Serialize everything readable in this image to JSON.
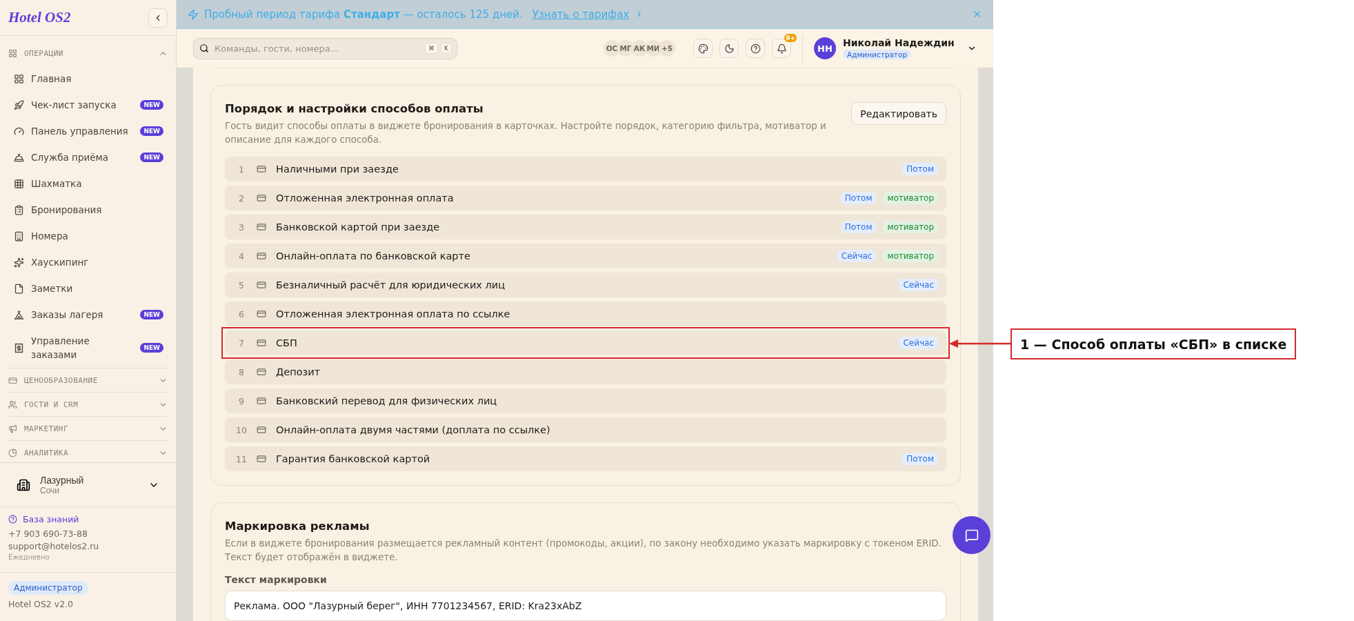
{
  "sidebar": {
    "logo": "Hotel OS2",
    "groups": [
      {
        "label": "ОПЕРАЦИИ",
        "expanded": true,
        "items": [
          {
            "label": "Главная"
          },
          {
            "label": "Чек-лист запуска",
            "badge": "NEW"
          },
          {
            "label": "Панель управления",
            "badge": "NEW"
          },
          {
            "label": "Служба приёма",
            "badge": "NEW"
          },
          {
            "label": "Шахматка"
          },
          {
            "label": "Бронирования"
          },
          {
            "label": "Номера"
          },
          {
            "label": "Хаускипинг"
          },
          {
            "label": "Заметки"
          },
          {
            "label": "Заказы лагеря",
            "badge": "NEW"
          },
          {
            "label": "Управление заказами",
            "badge": "NEW"
          }
        ]
      },
      {
        "label": "ЦЕНООБРАЗОВАНИЕ",
        "expanded": false
      },
      {
        "label": "ГОСТИ И CRM",
        "expanded": false
      },
      {
        "label": "МАРКЕТИНГ",
        "expanded": false
      },
      {
        "label": "АНАЛИТИКА",
        "expanded": false
      }
    ],
    "hotel": {
      "name": "Лазурный",
      "city": "Сочи"
    },
    "support": {
      "link": "База знаний",
      "phone": "+7 903 690-73-88",
      "email": "support@hotelos2.ru",
      "hours": "Ежедневно"
    },
    "role": "Администратор",
    "version": "Hotel OS2 v2.0"
  },
  "banner": {
    "text": "Пробный период тарифа **Стандарт** — осталось 125 дней.",
    "link": "Узнать о тарифах"
  },
  "header": {
    "search_placeholder": "Команды, гости, номера...",
    "shortcut": [
      "⌘",
      "K"
    ],
    "online_users": [
      "ОС",
      "МГ",
      "АК",
      "МИ",
      "+5"
    ],
    "notifications_badge": "9+",
    "user": {
      "initials": "НН",
      "name": "Николай Надеждин",
      "role": "Администратор"
    }
  },
  "payment_methods": {
    "title": "Порядок и настройки способов оплаты",
    "description": "Гость видит способы оплаты в виджете бронирования в карточках. Настройте порядок, категорию фильтра, мотиватор и описание для каждого способа.",
    "edit_button": "Редактировать",
    "rows": [
      {
        "number": "1",
        "name": "Наличными при заезде",
        "highlighted": false,
        "tags": [
          {
            "kind": "timing",
            "text": "Потом"
          }
        ]
      },
      {
        "number": "2",
        "name": "Отложенная электронная оплата",
        "highlighted": false,
        "tags": [
          {
            "kind": "timing",
            "text": "Потом"
          },
          {
            "kind": "motivator",
            "text": "мотиватор"
          }
        ]
      },
      {
        "number": "3",
        "name": "Банковской картой при заезде",
        "highlighted": false,
        "tags": [
          {
            "kind": "timing",
            "text": "Потом"
          },
          {
            "kind": "motivator",
            "text": "мотиватор"
          }
        ]
      },
      {
        "number": "4",
        "name": "Онлайн-оплата по банковской карте",
        "highlighted": false,
        "tags": [
          {
            "kind": "timing",
            "text": "Сейчас"
          },
          {
            "kind": "motivator",
            "text": "мотиватор"
          }
        ]
      },
      {
        "number": "5",
        "name": "Безналичный расчёт для юридических лиц",
        "highlighted": false,
        "tags": [
          {
            "kind": "timing",
            "text": "Сейчас"
          }
        ]
      },
      {
        "number": "6",
        "name": "Отложенная электронная оплата по ссылке",
        "highlighted": false
      },
      {
        "number": "7",
        "name": "СБП",
        "highlighted": true,
        "tags": [
          {
            "kind": "timing",
            "text": "Сейчас"
          }
        ]
      },
      {
        "number": "8",
        "name": "Депозит",
        "highlighted": false
      },
      {
        "number": "9",
        "name": "Банковский перевод для физических лиц",
        "highlighted": false
      },
      {
        "number": "10",
        "name": "Онлайн-оплата двумя частями (доплата по ссылке)",
        "highlighted": false
      },
      {
        "number": "11",
        "name": "Гарантия банковской картой",
        "highlighted": false,
        "tags": [
          {
            "kind": "timing",
            "text": "Потом"
          }
        ]
      }
    ]
  },
  "ad_marking": {
    "title": "Маркировка рекламы",
    "description": "Если в виджете бронирования размещается рекламный контент (промокоды, акции), по закону необходимо указать маркировку с токеном ERID. Текст будет отображён в виджете.",
    "field_label": "Текст маркировки",
    "field_value": "Реклама. ООО \"Лазурный берег\", ИНН 7701234567, ERID: Kra23xAbZ"
  },
  "annotation": {
    "text": "1 — Способ оплаты «СБП» в списке"
  }
}
